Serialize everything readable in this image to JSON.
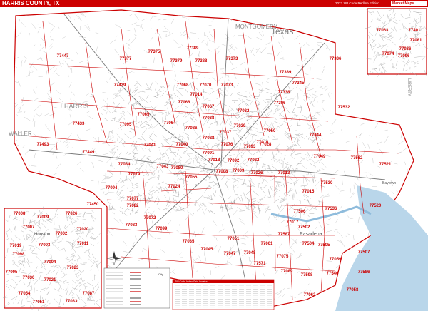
{
  "header": {
    "title": "HARRIS COUNTY, TX",
    "edition": "2023 ZIP Code Redline Edition",
    "logo": "Market Maps"
  },
  "colors": {
    "accent_red": "#cc0000",
    "zip_label": "#cc0000",
    "border": "#cc0000",
    "street": "#9a9a9a",
    "water": "#b9d6ea"
  },
  "labels": {
    "state": "Texas",
    "neighbors": [
      "MONTGOMERY",
      "HARRIS",
      "WALLER",
      "LIBERTY"
    ],
    "cities": [
      "Houston",
      "Pasadena",
      "Baytown"
    ]
  },
  "main_zips": [
    "77447",
    "77377",
    "77375",
    "77389",
    "77379",
    "77388",
    "77373",
    "77336",
    "77339",
    "77345",
    "77338",
    "77429",
    "77070",
    "77068",
    "77073",
    "77014",
    "77532",
    "77066",
    "77067",
    "77396",
    "77433",
    "77095",
    "77065",
    "77032",
    "77064",
    "77086",
    "77038",
    "77037",
    "77039",
    "77050",
    "77044",
    "77493",
    "77449",
    "77041",
    "77040",
    "77088",
    "77076",
    "77093",
    "77016",
    "77084",
    "77043",
    "77080",
    "77091",
    "77018",
    "77092",
    "77022",
    "77028",
    "77049",
    "77562",
    "77521",
    "77079",
    "77055",
    "77008",
    "77009",
    "77026",
    "77013",
    "77520",
    "77094",
    "77024",
    "77530",
    "77450",
    "77077",
    "77015",
    "77082",
    "77072",
    "77506",
    "77536",
    "77083",
    "77099",
    "77017",
    "77502",
    "77587",
    "77504",
    "77505",
    "77061",
    "77035",
    "77045",
    "77047",
    "77048",
    "77051",
    "77571",
    "77075",
    "77089",
    "77059",
    "77546",
    "77598",
    "77507",
    "77586",
    "77062",
    "77058"
  ],
  "inset_houston": {
    "label": "Houston",
    "zips": [
      "77008",
      "77009",
      "77026",
      "77007",
      "77020",
      "77002",
      "77019",
      "77098",
      "77003",
      "77011",
      "77004",
      "77005",
      "77030",
      "77023",
      "77021",
      "77054",
      "77087",
      "77051",
      "77033"
    ]
  },
  "inset_ne": {
    "zips": [
      "77063",
      "77074",
      "77036",
      "77096",
      "77401",
      "77081"
    ]
  },
  "legend": {
    "city_label": "City",
    "locator_title": "ZIP Code Index/Grid Locator"
  }
}
